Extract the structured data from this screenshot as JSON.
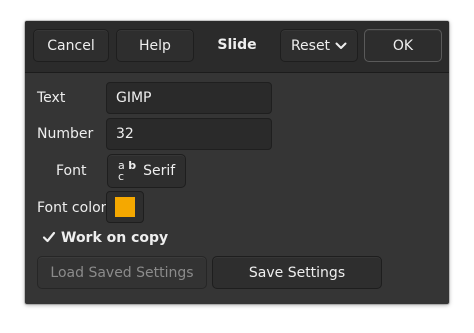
{
  "header": {
    "cancel_label": "Cancel",
    "help_label": "Help",
    "title": "Slide",
    "reset_label": "Reset",
    "ok_label": "OK"
  },
  "form": {
    "text_label": "Text",
    "text_value": "GIMP",
    "number_label": "Number",
    "number_value": "32",
    "font_label": "Font",
    "font_icon_top": "a",
    "font_icon_bottom": "c",
    "font_icon_b": "b",
    "font_value": "Serif",
    "font_color_label": "Font color",
    "font_color_value": "#f5a800",
    "work_on_copy_label": "Work on copy",
    "work_on_copy_checked": true
  },
  "footer": {
    "load_label": "Load Saved Settings",
    "save_label": "Save Settings"
  }
}
